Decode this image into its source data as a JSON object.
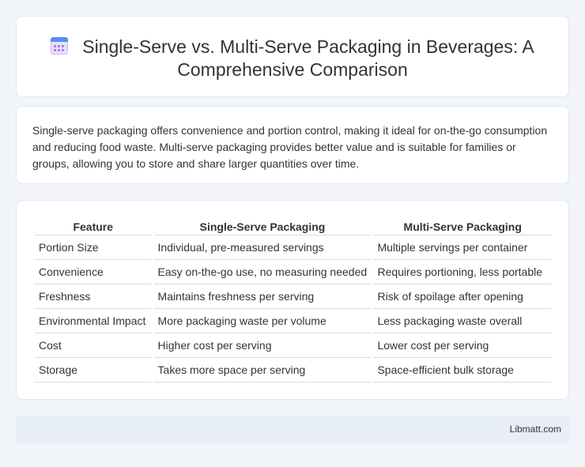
{
  "header": {
    "title": "Single-Serve vs. Multi-Serve Packaging in Beverages: A Comprehensive Comparison",
    "icon": "calendar-icon"
  },
  "summary": {
    "text": "Single-serve packaging offers convenience and portion control, making it ideal for on-the-go consumption and reducing food waste. Multi-serve packaging provides better value and is suitable for families or groups, allowing you to store and share larger quantities over time."
  },
  "table": {
    "headers": [
      "Feature",
      "Single-Serve Packaging",
      "Multi-Serve Packaging"
    ],
    "rows": [
      [
        "Portion Size",
        "Individual, pre-measured servings",
        "Multiple servings per container"
      ],
      [
        "Convenience",
        "Easy on-the-go use, no measuring needed",
        "Requires portioning, less portable"
      ],
      [
        "Freshness",
        "Maintains freshness per serving",
        "Risk of spoilage after opening"
      ],
      [
        "Environmental Impact",
        "More packaging waste per volume",
        "Less packaging waste overall"
      ],
      [
        "Cost",
        "Higher cost per serving",
        "Lower cost per serving"
      ],
      [
        "Storage",
        "Takes more space per serving",
        "Space-efficient bulk storage"
      ]
    ]
  },
  "footer": {
    "brand": "Libmatt.com"
  }
}
